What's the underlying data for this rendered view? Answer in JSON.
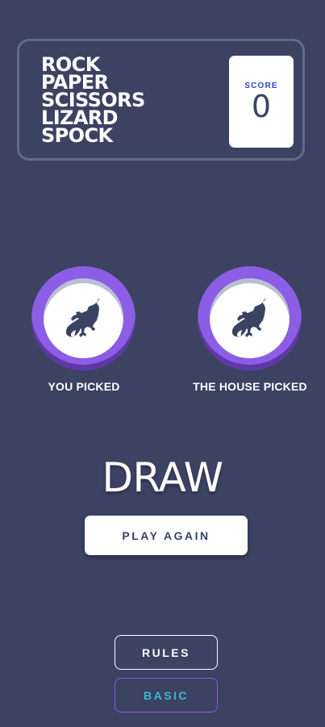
{
  "header": {
    "title_lines": [
      "ROCK",
      "PAPER",
      "SCISSORS",
      "LIZARD",
      "SPOCK"
    ],
    "score_label": "SCORE",
    "score_value": "0"
  },
  "picks": {
    "you": {
      "choice": "lizard",
      "label": "YOU PICKED",
      "icon": "lizard-icon",
      "color": "#8c5de5"
    },
    "house": {
      "choice": "lizard",
      "label": "THE HOUSE PICKED",
      "icon": "lizard-icon",
      "color": "#8c5de5"
    }
  },
  "result": {
    "text": "DRAW",
    "play_again_label": "PLAY AGAIN"
  },
  "footer": {
    "rules_label": "RULES",
    "mode_label": "BASIC"
  },
  "colors": {
    "background": "#3b4262",
    "header_border": "#606e85",
    "score_label": "#2a45c2",
    "score_value": "#3b4363",
    "lizard_ring": "#8c5de5",
    "basic_text": "#3fb7cd"
  }
}
